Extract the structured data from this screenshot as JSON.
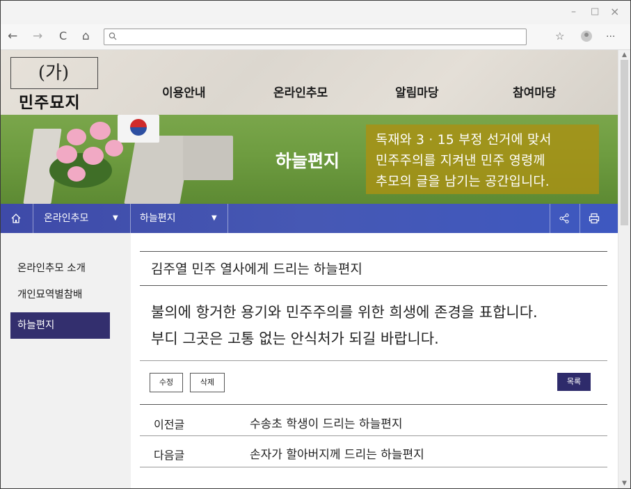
{
  "browser": {
    "window_controls": {
      "minimize": "–",
      "maximize": "□",
      "close": "×"
    },
    "nav": {
      "back": "←",
      "forward": "→",
      "reload": "C",
      "home": "⌂"
    },
    "address": {
      "value": "",
      "search_icon": "search-icon"
    },
    "toolbar": {
      "favorites": "☆",
      "menu": "···"
    }
  },
  "site": {
    "logo_label": "(가)",
    "logo_name": "민주묘지",
    "menu": [
      "이용안내",
      "온라인추모",
      "알림마당",
      "참여마당"
    ]
  },
  "banner": {
    "title": "하늘편지",
    "description_lines": [
      "독재와 3 · 15 부정 선거에 맞서",
      "민주주의를 지켜낸 민주 영령께",
      "추모의 글을 남기는 공간입니다."
    ],
    "box_color": "#aa9114"
  },
  "crumbs": {
    "home_icon": "home-icon",
    "level1": "온라인추모",
    "level2": "하늘편지",
    "share_icon": "share-icon",
    "print_icon": "print-icon"
  },
  "sidebar": {
    "items": [
      {
        "label": "온라인추모 소개",
        "active": false
      },
      {
        "label": "개인묘역별참배",
        "active": false
      },
      {
        "label": "하늘편지",
        "active": true
      }
    ]
  },
  "post": {
    "title": "김주열 민주 열사에게 드리는 하늘편지",
    "body_lines": [
      "불의에 항거한 용기와 민주주의를 위한 희생에 존경을 표합니다.",
      "부디 그곳은 고통 없는 안식처가 되길 바랍니다."
    ],
    "buttons": {
      "edit": "수정",
      "delete": "삭제",
      "list": "목록"
    },
    "prev": {
      "label": "이전글",
      "title": "수송초 학생이 드리는 하늘편지"
    },
    "next": {
      "label": "다음글",
      "title": "손자가 할아버지께 드리는 하늘편지"
    }
  },
  "colors": {
    "nav_blue": "#4658b4",
    "sidebar_active": "#332f6e",
    "list_button": "#2e2b6b"
  }
}
